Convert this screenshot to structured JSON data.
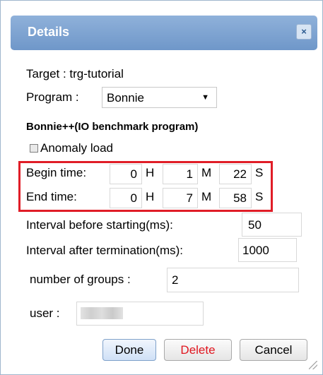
{
  "dialog": {
    "title": "Details",
    "close_icon": "close-icon",
    "close_glyph": "×"
  },
  "target": {
    "label": "Target : trg-tutorial"
  },
  "program": {
    "label": "Program :",
    "selected": "Bonnie",
    "caret": "▼",
    "description": "Bonnie++(IO benchmark program)"
  },
  "anomaly": {
    "label": "Anomaly load",
    "checked": false
  },
  "begin_time": {
    "label": "Begin time:",
    "hours": "0",
    "minutes": "1",
    "seconds": "22",
    "h_unit": "H",
    "m_unit": "M",
    "s_unit": "S"
  },
  "end_time": {
    "label": "End time:",
    "hours": "0",
    "minutes": "7",
    "seconds": "58",
    "h_unit": "H",
    "m_unit": "M",
    "s_unit": "S"
  },
  "interval_before": {
    "label": "Interval before starting(ms):",
    "value": "50"
  },
  "interval_after": {
    "label": "Interval after termination(ms):",
    "value": "1000"
  },
  "groups": {
    "label": "number of groups :",
    "value": "2"
  },
  "user": {
    "label": "user :"
  },
  "buttons": {
    "done": "Done",
    "delete": "Delete",
    "cancel": "Cancel"
  },
  "colors": {
    "title_bar": "#7aa0cf",
    "highlight_border": "#e01d27",
    "delete_text": "#e0161f"
  }
}
